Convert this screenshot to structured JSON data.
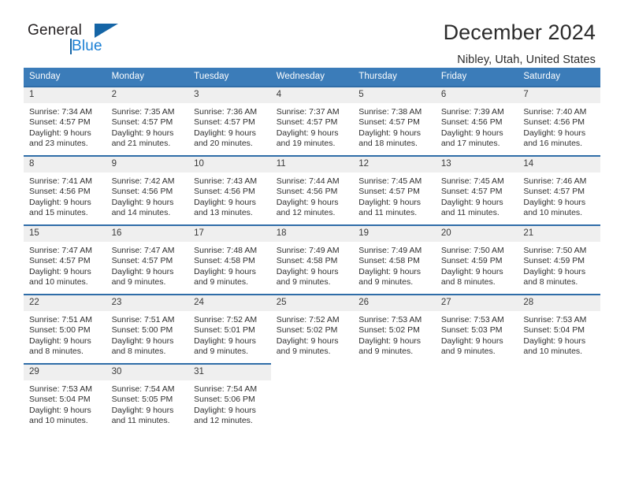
{
  "brand": {
    "name_part1": "General",
    "name_part2": "Blue",
    "triangle_icon": "triangle-icon",
    "accent_blue": "#1a7fd4",
    "logo_dark": "#231f20"
  },
  "header": {
    "title": "December 2024",
    "location": "Nibley, Utah, United States"
  },
  "calendar": {
    "header_bg": "#3b7cb9",
    "row_border": "#2f6da8",
    "daynum_bg": "#efefef",
    "weekdays": [
      "Sunday",
      "Monday",
      "Tuesday",
      "Wednesday",
      "Thursday",
      "Friday",
      "Saturday"
    ],
    "weeks": [
      [
        {
          "day": "1",
          "sunrise": "Sunrise: 7:34 AM",
          "sunset": "Sunset: 4:57 PM",
          "daylight1": "Daylight: 9 hours",
          "daylight2": "and 23 minutes."
        },
        {
          "day": "2",
          "sunrise": "Sunrise: 7:35 AM",
          "sunset": "Sunset: 4:57 PM",
          "daylight1": "Daylight: 9 hours",
          "daylight2": "and 21 minutes."
        },
        {
          "day": "3",
          "sunrise": "Sunrise: 7:36 AM",
          "sunset": "Sunset: 4:57 PM",
          "daylight1": "Daylight: 9 hours",
          "daylight2": "and 20 minutes."
        },
        {
          "day": "4",
          "sunrise": "Sunrise: 7:37 AM",
          "sunset": "Sunset: 4:57 PM",
          "daylight1": "Daylight: 9 hours",
          "daylight2": "and 19 minutes."
        },
        {
          "day": "5",
          "sunrise": "Sunrise: 7:38 AM",
          "sunset": "Sunset: 4:57 PM",
          "daylight1": "Daylight: 9 hours",
          "daylight2": "and 18 minutes."
        },
        {
          "day": "6",
          "sunrise": "Sunrise: 7:39 AM",
          "sunset": "Sunset: 4:56 PM",
          "daylight1": "Daylight: 9 hours",
          "daylight2": "and 17 minutes."
        },
        {
          "day": "7",
          "sunrise": "Sunrise: 7:40 AM",
          "sunset": "Sunset: 4:56 PM",
          "daylight1": "Daylight: 9 hours",
          "daylight2": "and 16 minutes."
        }
      ],
      [
        {
          "day": "8",
          "sunrise": "Sunrise: 7:41 AM",
          "sunset": "Sunset: 4:56 PM",
          "daylight1": "Daylight: 9 hours",
          "daylight2": "and 15 minutes."
        },
        {
          "day": "9",
          "sunrise": "Sunrise: 7:42 AM",
          "sunset": "Sunset: 4:56 PM",
          "daylight1": "Daylight: 9 hours",
          "daylight2": "and 14 minutes."
        },
        {
          "day": "10",
          "sunrise": "Sunrise: 7:43 AM",
          "sunset": "Sunset: 4:56 PM",
          "daylight1": "Daylight: 9 hours",
          "daylight2": "and 13 minutes."
        },
        {
          "day": "11",
          "sunrise": "Sunrise: 7:44 AM",
          "sunset": "Sunset: 4:56 PM",
          "daylight1": "Daylight: 9 hours",
          "daylight2": "and 12 minutes."
        },
        {
          "day": "12",
          "sunrise": "Sunrise: 7:45 AM",
          "sunset": "Sunset: 4:57 PM",
          "daylight1": "Daylight: 9 hours",
          "daylight2": "and 11 minutes."
        },
        {
          "day": "13",
          "sunrise": "Sunrise: 7:45 AM",
          "sunset": "Sunset: 4:57 PM",
          "daylight1": "Daylight: 9 hours",
          "daylight2": "and 11 minutes."
        },
        {
          "day": "14",
          "sunrise": "Sunrise: 7:46 AM",
          "sunset": "Sunset: 4:57 PM",
          "daylight1": "Daylight: 9 hours",
          "daylight2": "and 10 minutes."
        }
      ],
      [
        {
          "day": "15",
          "sunrise": "Sunrise: 7:47 AM",
          "sunset": "Sunset: 4:57 PM",
          "daylight1": "Daylight: 9 hours",
          "daylight2": "and 10 minutes."
        },
        {
          "day": "16",
          "sunrise": "Sunrise: 7:47 AM",
          "sunset": "Sunset: 4:57 PM",
          "daylight1": "Daylight: 9 hours",
          "daylight2": "and 9 minutes."
        },
        {
          "day": "17",
          "sunrise": "Sunrise: 7:48 AM",
          "sunset": "Sunset: 4:58 PM",
          "daylight1": "Daylight: 9 hours",
          "daylight2": "and 9 minutes."
        },
        {
          "day": "18",
          "sunrise": "Sunrise: 7:49 AM",
          "sunset": "Sunset: 4:58 PM",
          "daylight1": "Daylight: 9 hours",
          "daylight2": "and 9 minutes."
        },
        {
          "day": "19",
          "sunrise": "Sunrise: 7:49 AM",
          "sunset": "Sunset: 4:58 PM",
          "daylight1": "Daylight: 9 hours",
          "daylight2": "and 9 minutes."
        },
        {
          "day": "20",
          "sunrise": "Sunrise: 7:50 AM",
          "sunset": "Sunset: 4:59 PM",
          "daylight1": "Daylight: 9 hours",
          "daylight2": "and 8 minutes."
        },
        {
          "day": "21",
          "sunrise": "Sunrise: 7:50 AM",
          "sunset": "Sunset: 4:59 PM",
          "daylight1": "Daylight: 9 hours",
          "daylight2": "and 8 minutes."
        }
      ],
      [
        {
          "day": "22",
          "sunrise": "Sunrise: 7:51 AM",
          "sunset": "Sunset: 5:00 PM",
          "daylight1": "Daylight: 9 hours",
          "daylight2": "and 8 minutes."
        },
        {
          "day": "23",
          "sunrise": "Sunrise: 7:51 AM",
          "sunset": "Sunset: 5:00 PM",
          "daylight1": "Daylight: 9 hours",
          "daylight2": "and 8 minutes."
        },
        {
          "day": "24",
          "sunrise": "Sunrise: 7:52 AM",
          "sunset": "Sunset: 5:01 PM",
          "daylight1": "Daylight: 9 hours",
          "daylight2": "and 9 minutes."
        },
        {
          "day": "25",
          "sunrise": "Sunrise: 7:52 AM",
          "sunset": "Sunset: 5:02 PM",
          "daylight1": "Daylight: 9 hours",
          "daylight2": "and 9 minutes."
        },
        {
          "day": "26",
          "sunrise": "Sunrise: 7:53 AM",
          "sunset": "Sunset: 5:02 PM",
          "daylight1": "Daylight: 9 hours",
          "daylight2": "and 9 minutes."
        },
        {
          "day": "27",
          "sunrise": "Sunrise: 7:53 AM",
          "sunset": "Sunset: 5:03 PM",
          "daylight1": "Daylight: 9 hours",
          "daylight2": "and 9 minutes."
        },
        {
          "day": "28",
          "sunrise": "Sunrise: 7:53 AM",
          "sunset": "Sunset: 5:04 PM",
          "daylight1": "Daylight: 9 hours",
          "daylight2": "and 10 minutes."
        }
      ],
      [
        {
          "day": "29",
          "sunrise": "Sunrise: 7:53 AM",
          "sunset": "Sunset: 5:04 PM",
          "daylight1": "Daylight: 9 hours",
          "daylight2": "and 10 minutes."
        },
        {
          "day": "30",
          "sunrise": "Sunrise: 7:54 AM",
          "sunset": "Sunset: 5:05 PM",
          "daylight1": "Daylight: 9 hours",
          "daylight2": "and 11 minutes."
        },
        {
          "day": "31",
          "sunrise": "Sunrise: 7:54 AM",
          "sunset": "Sunset: 5:06 PM",
          "daylight1": "Daylight: 9 hours",
          "daylight2": "and 12 minutes."
        },
        {
          "day": "",
          "sunrise": "",
          "sunset": "",
          "daylight1": "",
          "daylight2": ""
        },
        {
          "day": "",
          "sunrise": "",
          "sunset": "",
          "daylight1": "",
          "daylight2": ""
        },
        {
          "day": "",
          "sunrise": "",
          "sunset": "",
          "daylight1": "",
          "daylight2": ""
        },
        {
          "day": "",
          "sunrise": "",
          "sunset": "",
          "daylight1": "",
          "daylight2": ""
        }
      ]
    ]
  }
}
